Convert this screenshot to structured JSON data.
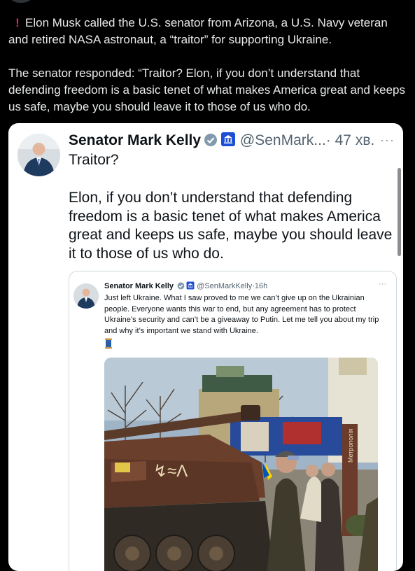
{
  "post": {
    "paragraph1": "Elon Musk called the U.S. senator from Arizona, a U.S. Navy veteran and retired NASA astronaut, a “traitor” for supporting Ukraine.",
    "paragraph2": "The senator responded: “Traitor? Elon, if you don’t understand that defending freedom is a basic tenet of what makes America great and keeps us safe, maybe you should leave it to those of us who do.",
    "warning_icon": "exclamation-icon",
    "warning_color": "#e0245e"
  },
  "tweet": {
    "author_name": "Senator Mark Kelly",
    "handle": "@SenMark...",
    "separator": "·",
    "time": "47 хв.",
    "more": "···",
    "line1": "Traitor?",
    "body": "Elon, if you don’t understand that defending freedom is a basic tenet of what makes America great and keeps us safe, maybe you should leave it to those of us who do.",
    "verified_color": "#829aab",
    "gov_badge_color": "#1d4fd6"
  },
  "quoted": {
    "author_name": "Senator Mark Kelly",
    "handle": "@SenMarkKelly",
    "separator": "·",
    "time": "16h",
    "more": "···",
    "body": "Just left Ukraine. What I saw proved to me we can’t give up on the Ukrainian people. Everyone wants this war to end, but any agreement has to protect Ukraine’s security and can’t be a giveaway to Putin. Let me tell you about my trip and why it’s important we stand with Ukraine.",
    "emoji_icon": "spool-of-thread-icon",
    "photo_sign": "Метрополія"
  }
}
